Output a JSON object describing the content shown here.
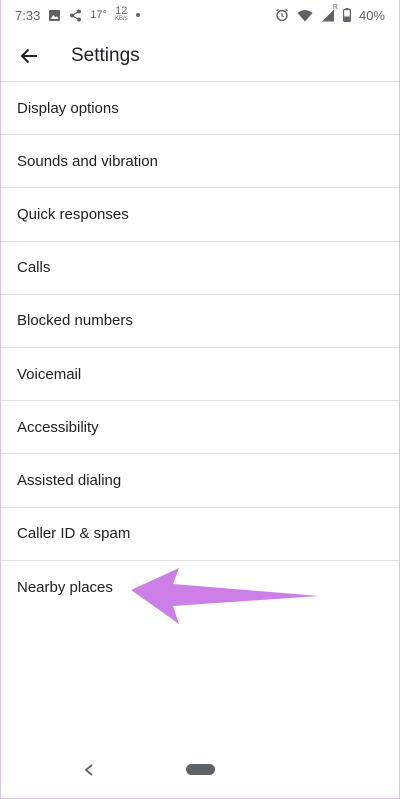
{
  "status_bar": {
    "time": "7:33",
    "temperature": "17°",
    "speed_value": "12",
    "speed_unit": "KB/s",
    "network_type": "R",
    "battery": "40%",
    "icons": [
      "image-icon",
      "share-icon",
      "alarm-icon",
      "wifi-icon",
      "signal-icon",
      "battery-icon"
    ]
  },
  "app_bar": {
    "title": "Settings",
    "back_icon": "arrow-back-icon"
  },
  "settings": {
    "items": [
      {
        "label": "Display options"
      },
      {
        "label": "Sounds and vibration"
      },
      {
        "label": "Quick responses"
      },
      {
        "label": "Calls"
      },
      {
        "label": "Blocked numbers"
      },
      {
        "label": "Voicemail"
      },
      {
        "label": "Accessibility"
      },
      {
        "label": "Assisted dialing"
      },
      {
        "label": "Caller ID & spam"
      },
      {
        "label": "Nearby places"
      }
    ]
  },
  "annotation": {
    "arrow_color": "#cc7fe6",
    "points_to": "Nearby places"
  },
  "nav_bar": {
    "back_icon": "nav-back-icon",
    "home_icon": "home-pill-icon"
  }
}
